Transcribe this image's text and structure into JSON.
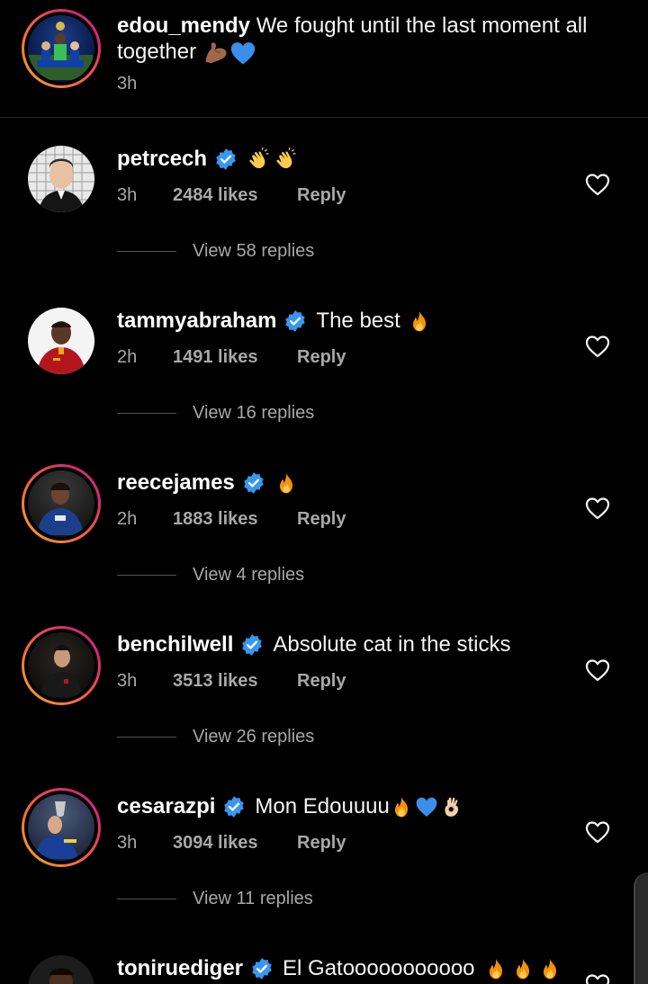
{
  "caption": {
    "username": "edou_mendy",
    "text": "We fought until the last moment all together",
    "emojis": [
      "flexed-biceps-emoji",
      "blue-heart-emoji"
    ],
    "time": "3h"
  },
  "comments": [
    {
      "username": "petrcech",
      "text": "",
      "emojis": [
        "clapping-hands-emoji",
        "clapping-hands-emoji"
      ],
      "time": "3h",
      "likes": "2484 likes",
      "reply": "Reply",
      "view_replies": "View 58 replies"
    },
    {
      "username": "tammyabraham",
      "text": "The best",
      "emojis": [
        "fire-emoji"
      ],
      "time": "2h",
      "likes": "1491 likes",
      "reply": "Reply",
      "view_replies": "View 16 replies"
    },
    {
      "username": "reecejames",
      "text": "",
      "emojis": [
        "fire-emoji"
      ],
      "time": "2h",
      "likes": "1883 likes",
      "reply": "Reply",
      "view_replies": "View 4 replies"
    },
    {
      "username": "benchilwell",
      "text": "Absolute cat in the sticks",
      "emojis": [],
      "time": "3h",
      "likes": "3513 likes",
      "reply": "Reply",
      "view_replies": "View 26 replies"
    },
    {
      "username": "cesarazpi",
      "text": "Mon Edouuuu",
      "emojis": [
        "fire-emoji",
        "blue-heart-emoji",
        "ok-hand-emoji"
      ],
      "time": "3h",
      "likes": "3094 likes",
      "reply": "Reply",
      "view_replies": "View 11 replies"
    },
    {
      "username": "toniruediger",
      "text": "El Gatooooooooooo",
      "emojis": [
        "fire-emoji",
        "fire-emoji",
        "fire-emoji"
      ],
      "time": "",
      "likes": "",
      "reply": "",
      "view_replies": ""
    }
  ],
  "colors": {
    "background": "#000000",
    "muted": "#a8a8a8",
    "verified": "#3897f0",
    "text": "#f5f5f5"
  }
}
